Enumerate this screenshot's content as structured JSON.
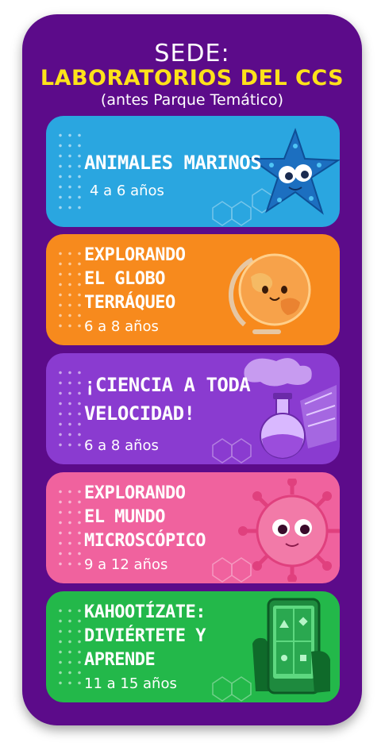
{
  "header": {
    "sede": "SEDE:",
    "laboratorios": "LABORATORIOS DEL CCS",
    "antes": "(antes Parque Temático)"
  },
  "cards": [
    {
      "title": "ANIMALES MARINOS",
      "age": "4 a 6 años",
      "color": "#2aa6e0",
      "icon": "starfish-icon"
    },
    {
      "title": "EXPLORANDO\nEL GLOBO\nTERRÁQUEO",
      "age": "6 a 8 años",
      "color": "#f78a1d",
      "icon": "globe-icon"
    },
    {
      "title": "¡CIENCIA A TODA\nVELOCIDAD!",
      "age": "6 a 8 años",
      "color": "#8a3bd0",
      "icon": "flask-icon"
    },
    {
      "title": "EXPLORANDO\nEL MUNDO\nMICROSCÓPICO",
      "age": "9 a 12 años",
      "color": "#f0629e",
      "icon": "microbe-icon"
    },
    {
      "title": "KAHOOTÍZATE:\nDIVIÉRTETE Y\nAPRENDE",
      "age": "11 a 15 años",
      "color": "#23b84a",
      "icon": "phone-icon"
    }
  ]
}
